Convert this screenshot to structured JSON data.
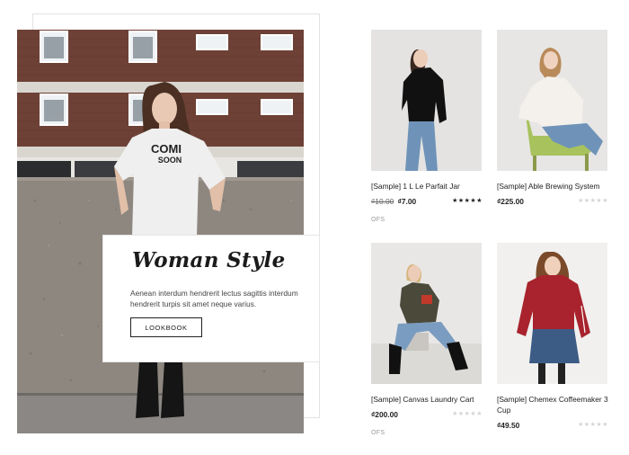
{
  "hero": {
    "title": "Woman Style",
    "text": "Aenean interdum hendrerit lectus sagittis interdum hendrerit turpis sit amet neque varius.",
    "button_label": "LOOKBOOK",
    "tshirt_print_line1": "COMI",
    "tshirt_print_line2": "SOON"
  },
  "products": [
    {
      "name": "[Sample] 1 L Le Parfait Jar",
      "price_old": "₫10.00",
      "price_new": "₫7.00",
      "rating": 5,
      "stock_label": "OFS"
    },
    {
      "name": "[Sample] Able Brewing System",
      "price": "₫225.00",
      "rating": 0
    },
    {
      "name": "[Sample] Canvas Laundry Cart",
      "price": "₫200.00",
      "rating": 0,
      "stock_label": "OFS"
    },
    {
      "name": "[Sample] Chemex Coffeemaker 3 Cup",
      "price": "₫49.50",
      "rating": 0
    }
  ],
  "colors": {
    "accent": "#222222",
    "star_on": "#222222",
    "star_off": "#d4d4d4"
  }
}
